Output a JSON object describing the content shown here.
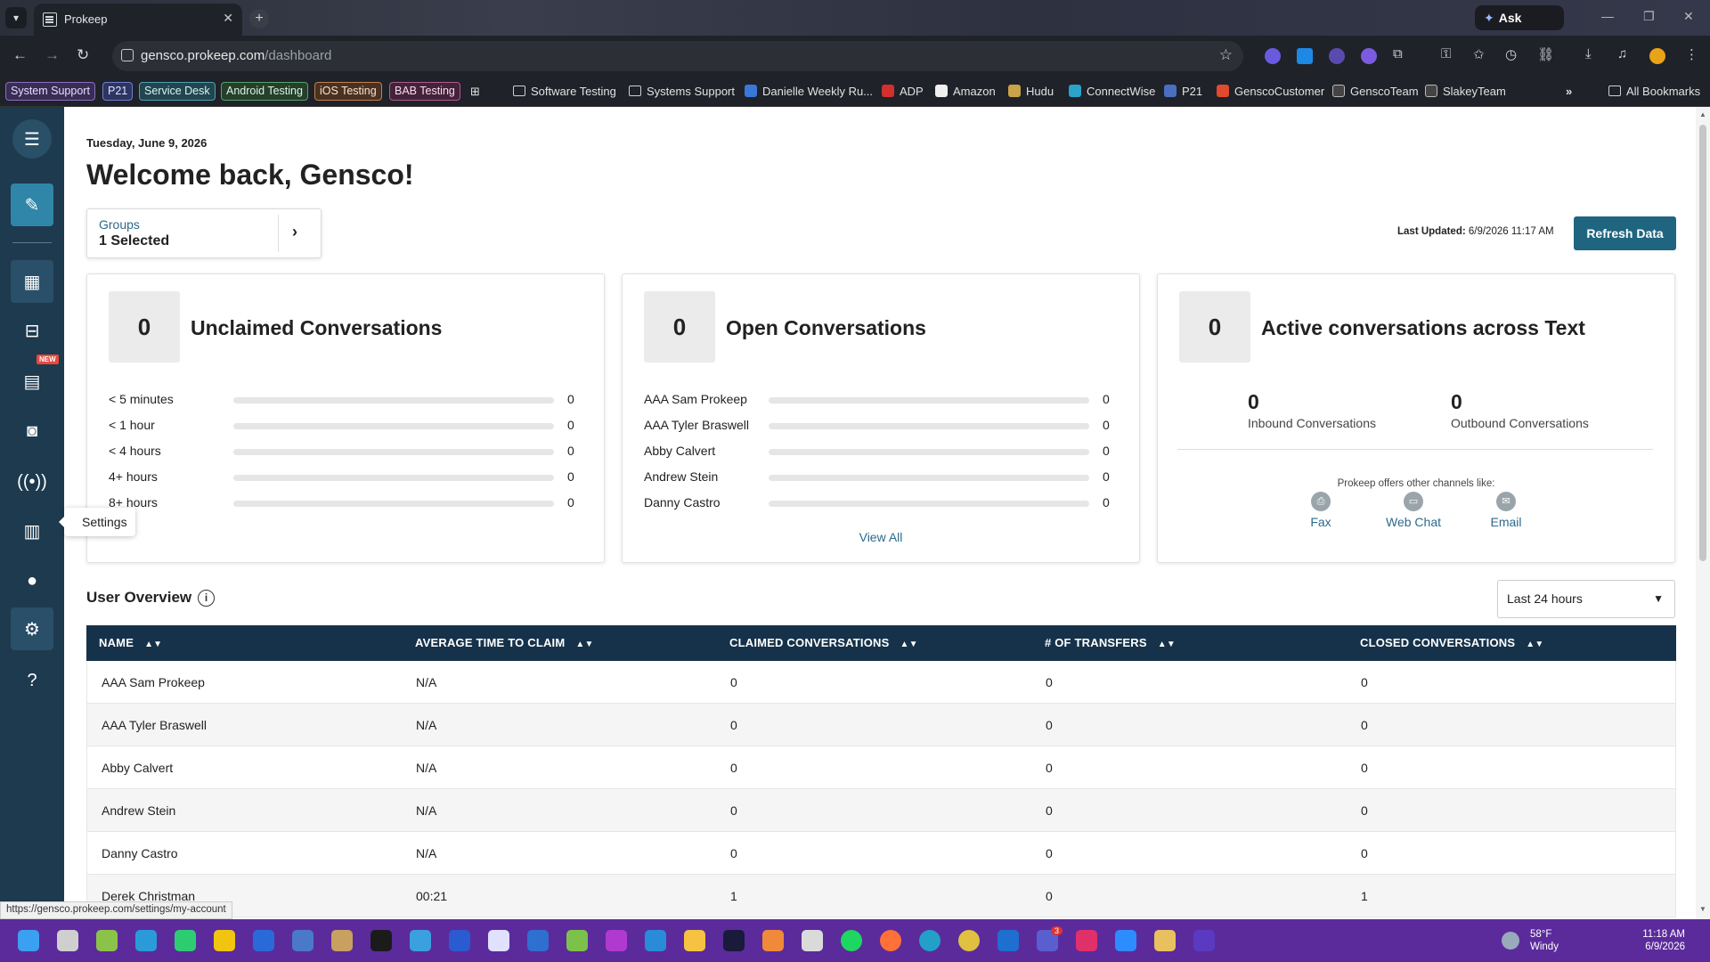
{
  "browser": {
    "tab_title": "Prokeep",
    "tab_close": "✕",
    "new_tab": "+",
    "gemini_label": "Ask Gemini",
    "url_host": "gensco.prokeep.com",
    "url_path": "/dashboard"
  },
  "bookmarks": {
    "chips": [
      {
        "label": "System Support",
        "color": "#6b4fa0"
      },
      {
        "label": "P21",
        "color": "#4a5fb0"
      },
      {
        "label": "Service Desk",
        "color": "#2f7c8c"
      },
      {
        "label": "Android Testing",
        "color": "#3c7a4a"
      },
      {
        "label": "iOS Testing",
        "color": "#a0622c"
      },
      {
        "label": "BAB Testing",
        "color": "#8c3f70"
      }
    ],
    "items": [
      "Software Testing",
      "Systems Support",
      "Danielle Weekly Ru...",
      "ADP",
      "Amazon",
      "Hudu",
      "ConnectWise",
      "P21",
      "GenscoCustomer",
      "GenscoTeam",
      "SlakeyTeam"
    ],
    "more": "»",
    "all_bookmarks": "All Bookmarks"
  },
  "sidebar": {
    "new_badge": "NEW",
    "tooltip": "Settings"
  },
  "header": {
    "date": "Tuesday, June 9, 2026",
    "welcome": "Welcome back, Gensco!",
    "groups_label": "Groups",
    "groups_value": "1 Selected",
    "last_updated_label": "Last Updated:",
    "last_updated_value": "6/9/2026  11:17 AM",
    "refresh_label": "Refresh Data"
  },
  "cards": {
    "unclaimed": {
      "count": "0",
      "title": "Unclaimed Conversations",
      "rows": [
        {
          "label": "< 5 minutes",
          "value": "0"
        },
        {
          "label": "< 1 hour",
          "value": "0"
        },
        {
          "label": "< 4 hours",
          "value": "0"
        },
        {
          "label": "4+ hours",
          "value": "0"
        },
        {
          "label": "8+ hours",
          "value": "0"
        }
      ]
    },
    "open": {
      "count": "0",
      "title": "Open Conversations",
      "rows": [
        {
          "label": "AAA Sam Prokeep",
          "value": "0"
        },
        {
          "label": "AAA Tyler Braswell",
          "value": "0"
        },
        {
          "label": "Abby Calvert",
          "value": "0"
        },
        {
          "label": "Andrew Stein",
          "value": "0"
        },
        {
          "label": "Danny Castro",
          "value": "0"
        }
      ],
      "view_all": "View All"
    },
    "active": {
      "count": "0",
      "title": "Active conversations across Text",
      "inbound_count": "0",
      "inbound_label": "Inbound Conversations",
      "outbound_count": "0",
      "outbound_label": "Outbound Conversations",
      "offers_text": "Prokeep offers other channels like:",
      "channels": [
        "Fax",
        "Web Chat",
        "Email"
      ]
    }
  },
  "user_overview": {
    "title": "User Overview",
    "range": "Last 24 hours",
    "columns": [
      "NAME",
      "AVERAGE TIME TO CLAIM",
      "CLAIMED CONVERSATIONS",
      "# OF TRANSFERS",
      "CLOSED CONVERSATIONS"
    ],
    "rows": [
      [
        "AAA Sam Prokeep",
        "N/A",
        "0",
        "0",
        "0"
      ],
      [
        "AAA Tyler Braswell",
        "N/A",
        "0",
        "0",
        "0"
      ],
      [
        "Abby Calvert",
        "N/A",
        "0",
        "0",
        "0"
      ],
      [
        "Andrew Stein",
        "N/A",
        "0",
        "0",
        "0"
      ],
      [
        "Danny Castro",
        "N/A",
        "0",
        "0",
        "0"
      ],
      [
        "Derek Christman",
        "00:21",
        "1",
        "0",
        "1"
      ]
    ]
  },
  "status_url": "https://gensco.prokeep.com/settings/my-account",
  "taskbar": {
    "temp": "58°F",
    "condition": "Windy",
    "time": "11:18 AM",
    "date": "6/9/2026",
    "teams_badge": "3"
  },
  "colors": {
    "sidebar": "#1d3a4f",
    "accent": "#1f6580",
    "table_header": "#16324a",
    "link": "#2c6a8a"
  }
}
